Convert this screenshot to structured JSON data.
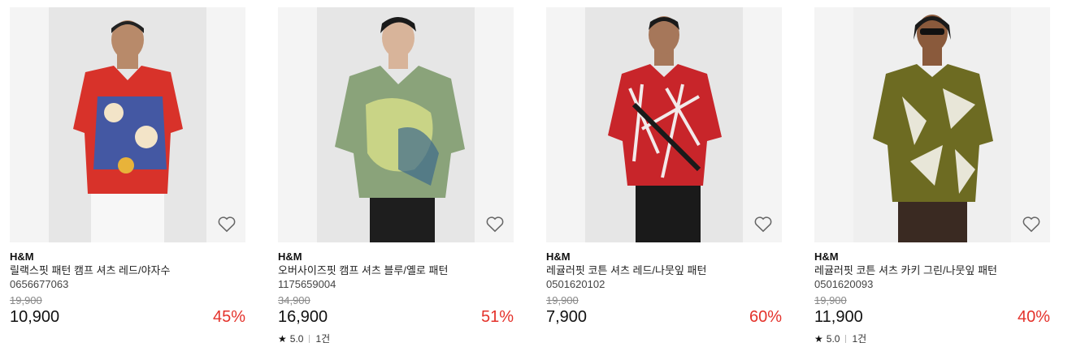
{
  "products": [
    {
      "brand": "H&M",
      "name": "릴랙스핏 패턴 캠프 셔츠 레드/야자수",
      "code": "0656677063",
      "original_price": "19,900",
      "price": "10,900",
      "discount": "45%",
      "rating": null,
      "reviews": null
    },
    {
      "brand": "H&M",
      "name": "오버사이즈핏 캠프 셔츠 블루/옐로 패턴",
      "code": "1175659004",
      "original_price": "34,900",
      "price": "16,900",
      "discount": "51%",
      "rating": "5.0",
      "reviews": "1건"
    },
    {
      "brand": "H&M",
      "name": "레귤러핏 코튼 셔츠 레드/나뭇잎 패턴",
      "code": "0501620102",
      "original_price": "19,900",
      "price": "7,900",
      "discount": "60%",
      "rating": null,
      "reviews": null
    },
    {
      "brand": "H&M",
      "name": "레귤러핏 코튼 셔츠 카키 그린/나뭇잎 패턴",
      "code": "0501620093",
      "original_price": "19,900",
      "price": "11,900",
      "discount": "40%",
      "rating": "5.0",
      "reviews": "1건"
    }
  ],
  "icons": {
    "wishlist": "heart-outline-icon",
    "star": "star-icon"
  },
  "colors": {
    "discount": "#e4322b",
    "text": "#111111",
    "muted": "#888888"
  }
}
